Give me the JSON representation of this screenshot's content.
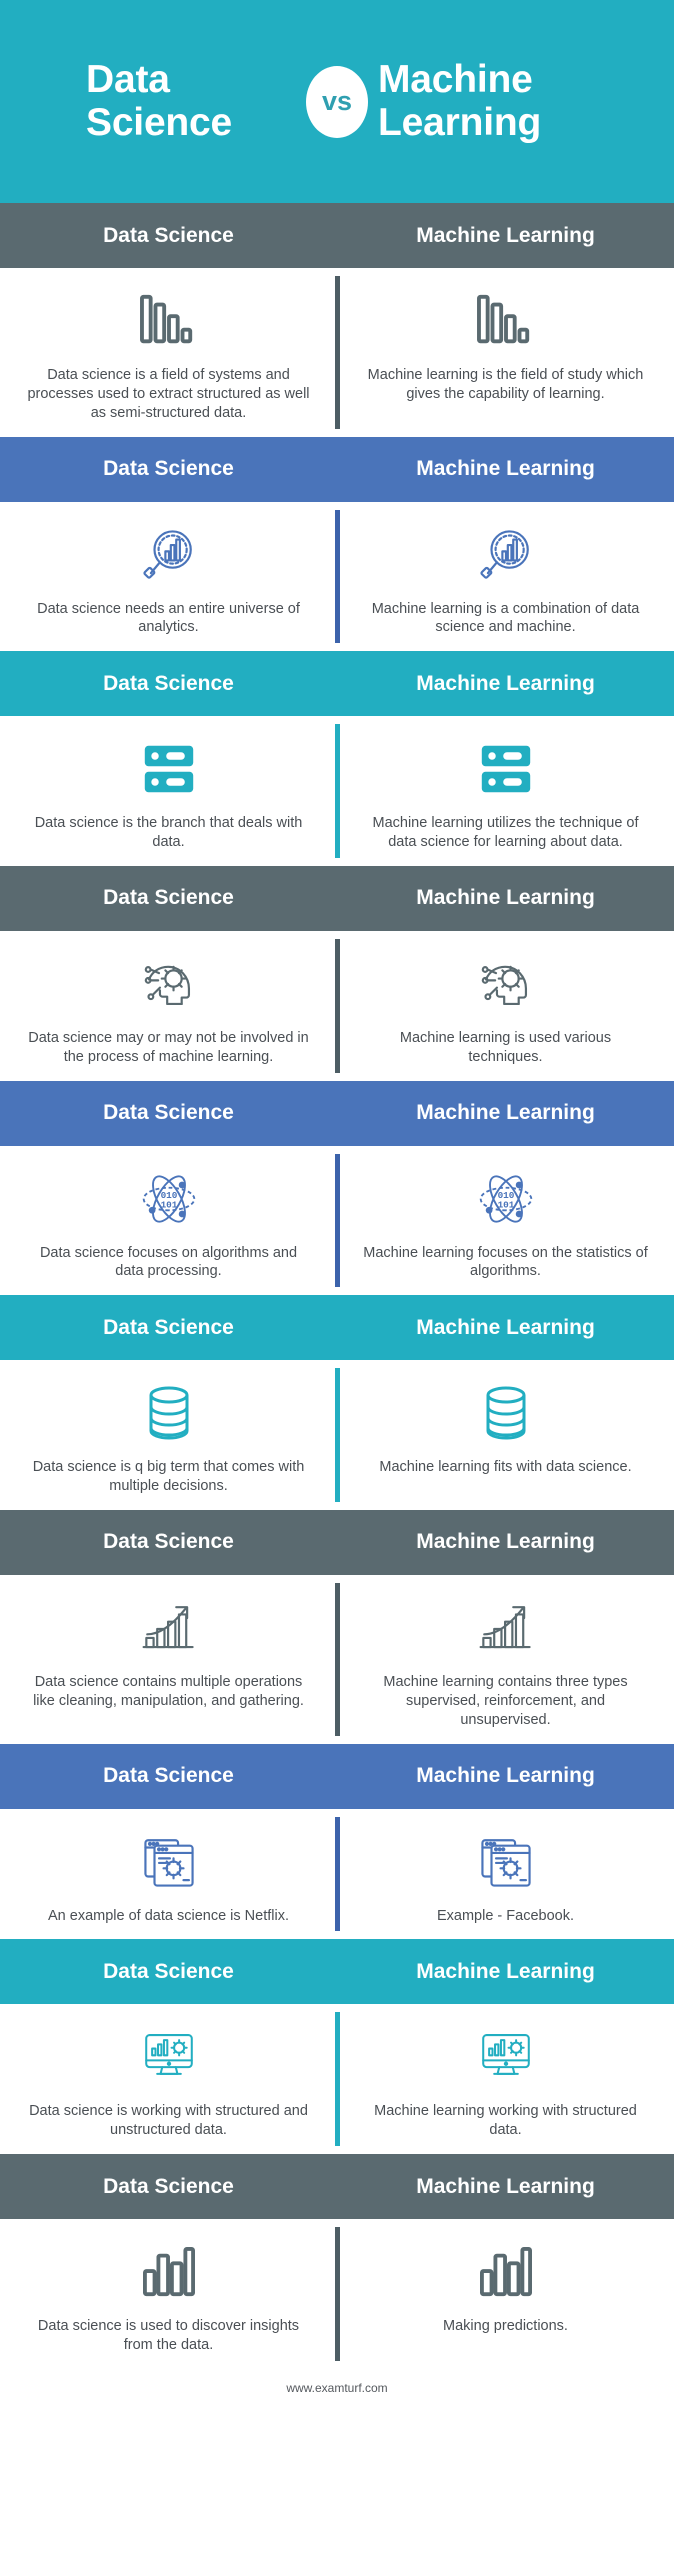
{
  "colors": {
    "teal": "#22aec1",
    "gray": "#5a6a70",
    "blue": "#4a74ba",
    "text": "#4a4f54",
    "white": "#ffffff"
  },
  "hero": {
    "left_title": "Data\nScience",
    "vs_label": "vs",
    "right_title": "Machine\nLearning"
  },
  "column_headers": {
    "left": "Data Science",
    "right": "Machine Learning"
  },
  "footer": {
    "site": "www.examturf.com"
  },
  "rows": [
    {
      "band_color": "gray",
      "icon": "bar-chart-solid-icon",
      "left_header": "Data Science",
      "right_header": "Machine Learning",
      "left_text": "Data science is a field of systems and processes used to extract structured as well as semi-structured data.",
      "right_text": "Machine learning is the field of study which gives the capability of learning."
    },
    {
      "band_color": "blue",
      "icon": "magnifier-chart-icon",
      "left_header": "Data Science",
      "right_header": "Machine Learning",
      "left_text": "Data science needs an entire universe of analytics.",
      "right_text": "Machine learning is a combination of data science and machine."
    },
    {
      "band_color": "teal",
      "icon": "server-rack-icon",
      "left_header": "Data Science",
      "right_header": "Machine Learning",
      "left_text": "Data science is the branch that deals with data.",
      "right_text": "Machine learning utilizes the technique of data science for learning about data."
    },
    {
      "band_color": "gray",
      "icon": "head-gear-ai-icon",
      "left_header": "Data Science",
      "right_header": "Machine Learning",
      "left_text": "Data science may or may not be involved in the process of machine learning.",
      "right_text": "Machine learning is used various techniques."
    },
    {
      "band_color": "blue",
      "icon": "atom-binary-icon",
      "icon_label": "010\n101",
      "left_header": "Data Science",
      "right_header": "Machine Learning",
      "left_text": "Data science focuses on algorithms and data processing.",
      "right_text": "Machine learning focuses on the statistics of algorithms."
    },
    {
      "band_color": "teal",
      "icon": "database-cylinder-icon",
      "left_header": "Data Science",
      "right_header": "Machine Learning",
      "left_text": "Data science is q big term that comes with multiple decisions.",
      "right_text": "Machine learning fits with data science."
    },
    {
      "band_color": "gray",
      "icon": "growth-chart-arrow-icon",
      "left_header": "Data Science",
      "right_header": "Machine Learning",
      "left_text": "Data science contains multiple operations like cleaning, manipulation, and gathering.",
      "right_text": "Machine learning contains three types supervised, reinforcement, and unsupervised."
    },
    {
      "band_color": "blue",
      "icon": "browser-windows-gear-icon",
      "left_header": "Data Science",
      "right_header": "Machine Learning",
      "left_text": "An example of data science is Netflix.",
      "right_text": "Example - Facebook."
    },
    {
      "band_color": "teal",
      "icon": "monitor-analytics-gear-icon",
      "left_header": "Data Science",
      "right_header": "Machine Learning",
      "left_text": "Data science is working with structured and unstructured data.",
      "right_text": "Machine learning working with structured data."
    },
    {
      "band_color": "gray",
      "icon": "bar-chart-outline-icon",
      "left_header": "Data Science",
      "right_header": "Machine Learning",
      "left_text": "Data science is used to discover insights from the data.",
      "right_text": "Making predictions."
    }
  ]
}
